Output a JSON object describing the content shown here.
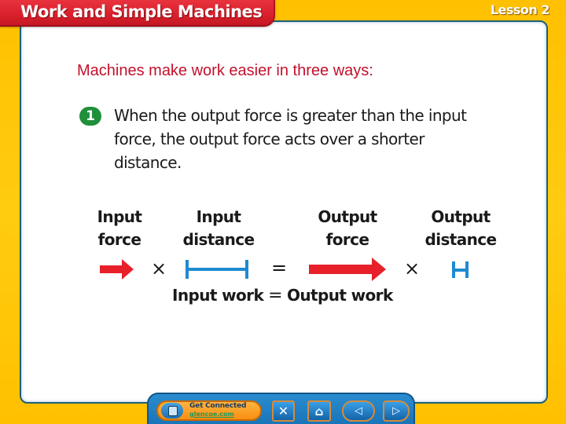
{
  "header": {
    "title": "Work and Simple Machines",
    "lesson": "Lesson 2"
  },
  "content": {
    "intro": "Machines make work easier in three ways:",
    "point": {
      "number": "1",
      "text": "When the output force is greater than the input force, the output force acts over a shorter distance."
    },
    "diagram": {
      "labels": {
        "input_force": [
          "Input",
          "force"
        ],
        "input_distance": [
          "Input",
          "distance"
        ],
        "output_force": [
          "Output",
          "force"
        ],
        "output_distance": [
          "Output",
          "distance"
        ]
      },
      "operators": {
        "times": "×",
        "equals": "="
      },
      "equation": {
        "left": "Input work",
        "equals": "=",
        "right": "Output work"
      },
      "colors": {
        "force_arrow": "#e8202a",
        "distance_bar": "#1f8ad0"
      }
    }
  },
  "navbar": {
    "get_connected": {
      "title": "Get Connected",
      "url": "glencoe.com"
    },
    "buttons": {
      "close": "✕",
      "home": "⌂",
      "prev": "◁",
      "next": "▷"
    }
  },
  "colors": {
    "frame": "#ffc400",
    "title_bar": "#d9202c",
    "intro_text": "#c4102c",
    "badge": "#1f8f3a",
    "nav": "#1a74b8"
  }
}
